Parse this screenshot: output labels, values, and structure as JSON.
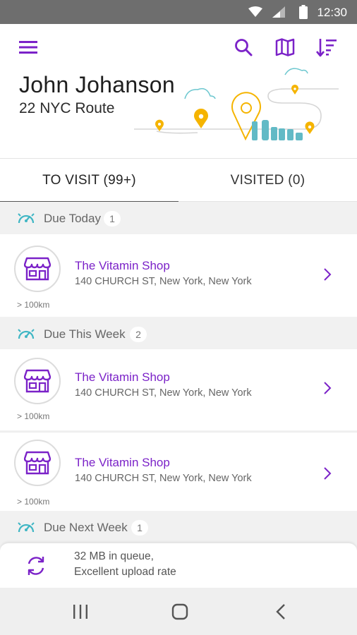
{
  "status_bar": {
    "time": "12:30",
    "icons": [
      "wifi-icon",
      "signal-icon",
      "battery-icon"
    ]
  },
  "header": {
    "icons": [
      "menu-icon",
      "search-icon",
      "map-icon",
      "sort-icon"
    ],
    "user_name": "John Johanson",
    "route_name": "22 NYC Route"
  },
  "tabs": [
    {
      "label": "TO VISIT (99+)",
      "active": true
    },
    {
      "label": "VISITED (0)",
      "active": false
    }
  ],
  "sections": [
    {
      "label": "Due Today",
      "count": "1",
      "stores": [
        {
          "name": "The Vitamin Shop",
          "address": "140 CHURCH ST, New York, New York",
          "distance": "> 100km"
        }
      ]
    },
    {
      "label": "Due This Week",
      "count": "2",
      "stores": [
        {
          "name": "The Vitamin Shop",
          "address": "140 CHURCH ST, New York, New York",
          "distance": "> 100km"
        },
        {
          "name": "The Vitamin Shop",
          "address": "140 CHURCH ST, New York, New York",
          "distance": "> 100km"
        }
      ]
    },
    {
      "label": "Due Next Week",
      "count": "1",
      "stores": []
    }
  ],
  "upload_status": {
    "line1": "32 MB in queue,",
    "line2": "Excellent upload rate"
  },
  "nav_bar": {
    "icons": [
      "recents-icon",
      "home-icon",
      "back-icon"
    ]
  },
  "colors": {
    "accent": "#7b22c8",
    "teal": "#3fb6c4",
    "pin": "#f5b400",
    "status_bar": "#6e6e6e"
  }
}
